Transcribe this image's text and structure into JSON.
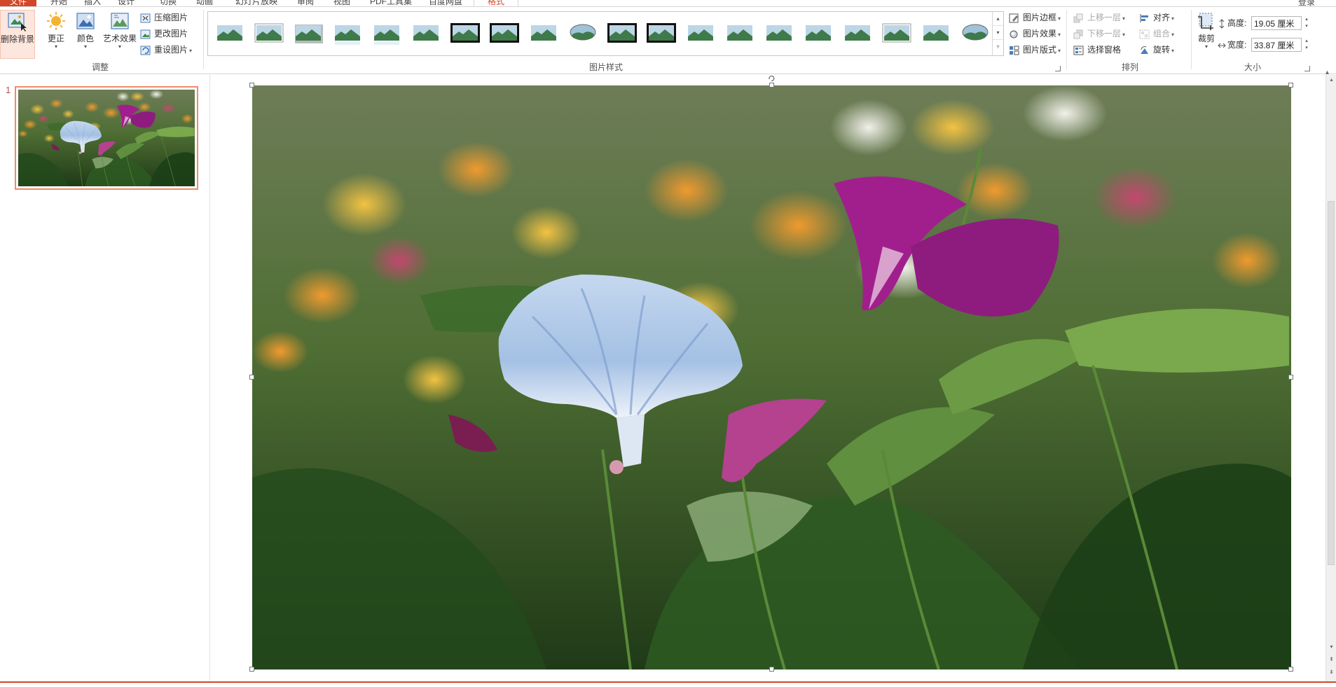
{
  "tabs": [
    {
      "label": "文件",
      "cls": "file"
    },
    {
      "label": "开始"
    },
    {
      "label": "插入"
    },
    {
      "label": "设计"
    },
    {
      "label": "切换"
    },
    {
      "label": "动画"
    },
    {
      "label": "幻灯片放映"
    },
    {
      "label": "审阅"
    },
    {
      "label": "视图"
    },
    {
      "label": "PDF工具集"
    },
    {
      "label": "百度网盘"
    },
    {
      "label": "格式",
      "cls": "active"
    }
  ],
  "user_label": "登录",
  "ribbon": {
    "adjust": {
      "label": "调整",
      "remove_bg": "删除背景",
      "correct": "更正",
      "color": "颜色",
      "art_effects": "艺术效果",
      "compress": "压缩图片",
      "change": "更改图片",
      "reset": "重设图片"
    },
    "styles": {
      "label": "图片样式",
      "border": "图片边框",
      "effects": "图片效果",
      "layout": "图片版式",
      "gallery_count": 20
    },
    "arrange": {
      "label": "排列",
      "bring_forward": "上移一层",
      "send_backward": "下移一层",
      "selection_pane": "选择窗格",
      "align": "对齐",
      "group": "组合",
      "rotate": "旋转"
    },
    "size": {
      "label": "大小",
      "crop": "裁剪",
      "height_label": "高度:",
      "height_value": "19.05 厘米",
      "width_label": "宽度:",
      "width_value": "33.87 厘米"
    }
  },
  "slides": [
    {
      "number": "1",
      "selected": true
    }
  ],
  "colors": {
    "accent": "#d24726",
    "thumb_border": "#ec8c6b"
  },
  "icons": {
    "remove_bg": "remove-background-icon",
    "correct": "sun-correction-icon",
    "color": "color-icon",
    "art": "artistic-effects-icon",
    "crop": "crop-icon"
  }
}
